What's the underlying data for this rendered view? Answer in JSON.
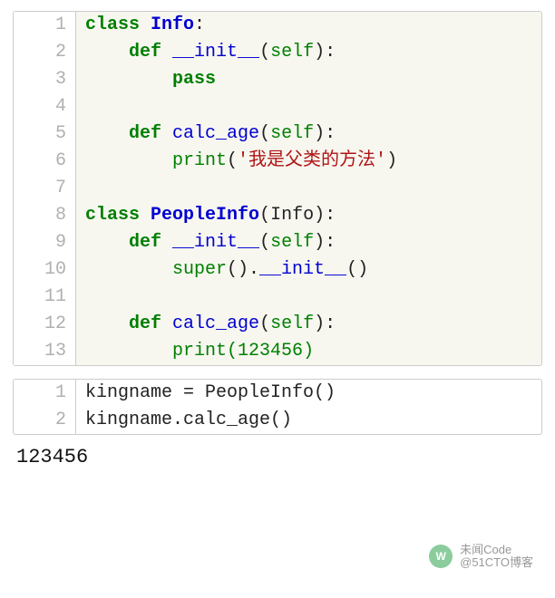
{
  "block1": {
    "lines": [
      {
        "n": "1",
        "tokens": [
          {
            "cls": "tok-kw",
            "t": "class"
          },
          {
            "cls": "tok-plain",
            "t": " "
          },
          {
            "cls": "tok-name",
            "t": "Info"
          },
          {
            "cls": "tok-plain",
            "t": ":"
          }
        ]
      },
      {
        "n": "2",
        "tokens": [
          {
            "cls": "tok-plain",
            "t": "    "
          },
          {
            "cls": "tok-kw",
            "t": "def"
          },
          {
            "cls": "tok-plain",
            "t": " "
          },
          {
            "cls": "tok-func",
            "t": "__init__"
          },
          {
            "cls": "tok-plain",
            "t": "("
          },
          {
            "cls": "tok-builtin",
            "t": "self"
          },
          {
            "cls": "tok-plain",
            "t": "):"
          }
        ]
      },
      {
        "n": "3",
        "tokens": [
          {
            "cls": "tok-plain",
            "t": "        "
          },
          {
            "cls": "tok-kw",
            "t": "pass"
          }
        ]
      },
      {
        "n": "4",
        "tokens": [
          {
            "cls": "tok-plain",
            "t": ""
          }
        ]
      },
      {
        "n": "5",
        "tokens": [
          {
            "cls": "tok-plain",
            "t": "    "
          },
          {
            "cls": "tok-kw",
            "t": "def"
          },
          {
            "cls": "tok-plain",
            "t": " "
          },
          {
            "cls": "tok-func",
            "t": "calc_age"
          },
          {
            "cls": "tok-plain",
            "t": "("
          },
          {
            "cls": "tok-builtin",
            "t": "self"
          },
          {
            "cls": "tok-plain",
            "t": "):"
          }
        ]
      },
      {
        "n": "6",
        "tokens": [
          {
            "cls": "tok-plain",
            "t": "        "
          },
          {
            "cls": "tok-builtin",
            "t": "print"
          },
          {
            "cls": "tok-plain",
            "t": "("
          },
          {
            "cls": "tok-str",
            "t": "'我是父类的方法'"
          },
          {
            "cls": "tok-plain",
            "t": ")"
          }
        ]
      },
      {
        "n": "7",
        "tokens": [
          {
            "cls": "tok-plain",
            "t": ""
          }
        ]
      },
      {
        "n": "8",
        "tokens": [
          {
            "cls": "tok-kw",
            "t": "class"
          },
          {
            "cls": "tok-plain",
            "t": " "
          },
          {
            "cls": "tok-name",
            "t": "PeopleInfo"
          },
          {
            "cls": "tok-plain",
            "t": "(Info):"
          }
        ]
      },
      {
        "n": "9",
        "tokens": [
          {
            "cls": "tok-plain",
            "t": "    "
          },
          {
            "cls": "tok-kw",
            "t": "def"
          },
          {
            "cls": "tok-plain",
            "t": " "
          },
          {
            "cls": "tok-func",
            "t": "__init__"
          },
          {
            "cls": "tok-plain",
            "t": "("
          },
          {
            "cls": "tok-builtin",
            "t": "self"
          },
          {
            "cls": "tok-plain",
            "t": "):"
          }
        ]
      },
      {
        "n": "10",
        "tokens": [
          {
            "cls": "tok-plain",
            "t": "        "
          },
          {
            "cls": "tok-builtin",
            "t": "super"
          },
          {
            "cls": "tok-plain",
            "t": "()."
          },
          {
            "cls": "tok-func",
            "t": "__init__"
          },
          {
            "cls": "tok-plain",
            "t": "()"
          }
        ]
      },
      {
        "n": "11",
        "tokens": [
          {
            "cls": "tok-plain",
            "t": ""
          }
        ]
      },
      {
        "n": "12",
        "tokens": [
          {
            "cls": "tok-plain",
            "t": "    "
          },
          {
            "cls": "tok-kw",
            "t": "def"
          },
          {
            "cls": "tok-plain",
            "t": " "
          },
          {
            "cls": "tok-func",
            "t": "calc_age"
          },
          {
            "cls": "tok-plain",
            "t": "("
          },
          {
            "cls": "tok-builtin",
            "t": "self"
          },
          {
            "cls": "tok-plain",
            "t": "):"
          }
        ]
      },
      {
        "n": "13",
        "tokens": [
          {
            "cls": "tok-plain",
            "t": "        "
          },
          {
            "cls": "tok-builtin",
            "t": "print"
          },
          {
            "cls": "tok-num",
            "t": "("
          },
          {
            "cls": "tok-num",
            "t": "123456"
          },
          {
            "cls": "tok-num",
            "t": ")"
          }
        ]
      }
    ]
  },
  "block2": {
    "lines": [
      {
        "n": "1",
        "tokens": [
          {
            "cls": "tok-plain",
            "t": "kingname = PeopleInfo()"
          }
        ]
      },
      {
        "n": "2",
        "tokens": [
          {
            "cls": "tok-plain",
            "t": "kingname.calc_age()"
          }
        ]
      }
    ]
  },
  "output": "123456",
  "watermark": {
    "line1": "未闻Code",
    "line2": "@51CTO博客"
  }
}
